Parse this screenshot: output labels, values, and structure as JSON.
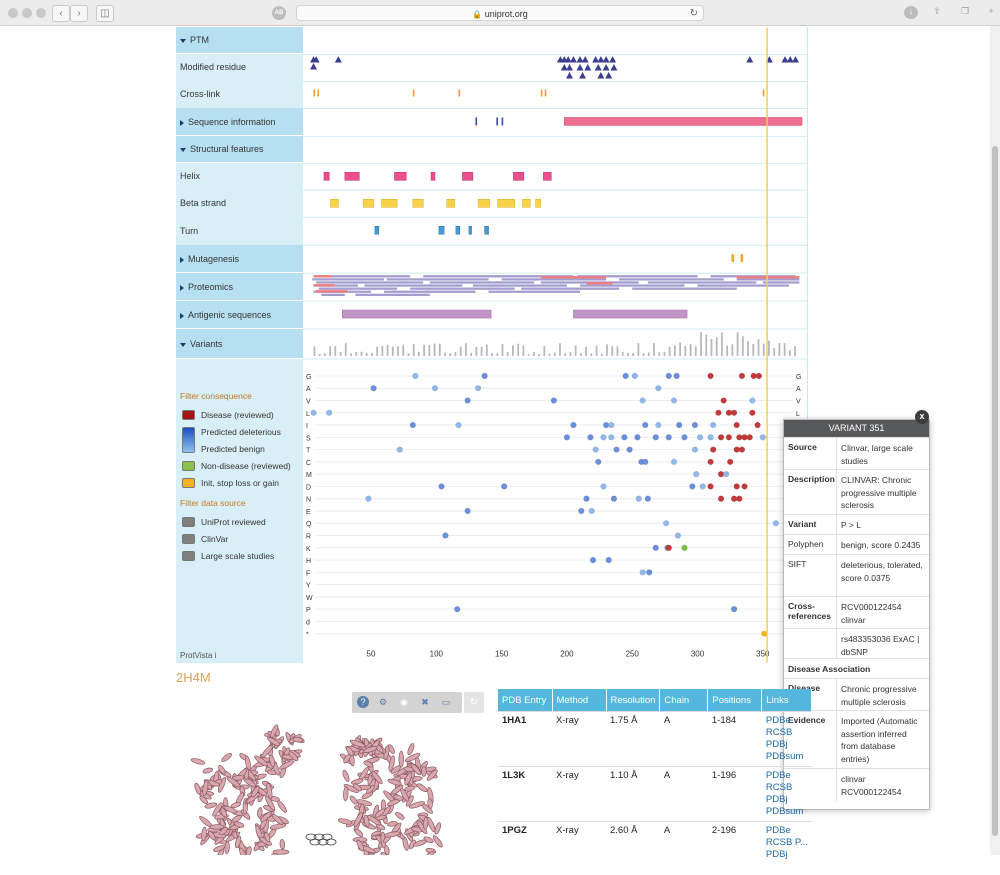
{
  "browser": {
    "url": "uniprot.org",
    "ab_label": "AB"
  },
  "tracks": {
    "rows": [
      {
        "label": "PTM",
        "type": "category",
        "expanded": true
      },
      {
        "label": "Modified residue",
        "type": "track"
      },
      {
        "label": "Cross-link",
        "type": "track"
      },
      {
        "label": "Sequence information",
        "type": "category",
        "expanded": false
      },
      {
        "label": "Structural features",
        "type": "category",
        "expanded": true
      },
      {
        "label": "Helix",
        "type": "track"
      },
      {
        "label": "Beta strand",
        "type": "track"
      },
      {
        "label": "Turn",
        "type": "track"
      },
      {
        "label": "Mutagenesis",
        "type": "category",
        "expanded": false
      },
      {
        "label": "Proteomics",
        "type": "category",
        "expanded": false
      },
      {
        "label": "Antigenic sequences",
        "type": "category",
        "expanded": false
      },
      {
        "label": "Variants",
        "type": "category",
        "expanded": true
      }
    ],
    "residues": [
      "G",
      "A",
      "V",
      "L",
      "I",
      "S",
      "T",
      "C",
      "M",
      "D",
      "N",
      "E",
      "Q",
      "R",
      "K",
      "H",
      "F",
      "Y",
      "W",
      "P",
      "d",
      "*"
    ],
    "x_axis": {
      "ticks": [
        50,
        100,
        150,
        200,
        250,
        300,
        350
      ],
      "min": 1,
      "max": 380
    }
  },
  "legend": {
    "filter_consequence": "Filter consequence",
    "consequence_items": [
      {
        "label": "Disease (reviewed)",
        "color": "#a31515"
      },
      {
        "label": "Predicted deleterious",
        "color": "#2f6dc7"
      },
      {
        "label": "Predicted benign",
        "color": "#a9d3ee"
      },
      {
        "label": "Non-disease (reviewed)",
        "color": "#8bc34a"
      },
      {
        "label": "Init, stop loss or gain",
        "color": "#f5b31d"
      }
    ],
    "filter_source": "Filter data source",
    "source_items": [
      {
        "label": "UniProt reviewed",
        "color": "#808080"
      },
      {
        "label": "ClinVar",
        "color": "#808080"
      },
      {
        "label": "Large scale studies",
        "color": "#808080"
      }
    ],
    "protvista": "ProtVista i"
  },
  "popup": {
    "title": "VARIANT 351",
    "close": "x",
    "rows": [
      {
        "key": "Source",
        "value": "Clinvar, large scale studies",
        "bold": true
      },
      {
        "key": "Description",
        "value": "CLINVAR: Chronic progressive multiple sclerosis",
        "bold": true
      },
      {
        "key": "Variant",
        "value": "P > L",
        "bold": true
      },
      {
        "key": "Polyphen",
        "value": "benign, score 0.2435",
        "bold": false
      },
      {
        "key": "SIFT",
        "value": "deleterious, tolerated, score 0.0375",
        "bold": false
      },
      {
        "key": "Cross-references",
        "value": "RCV000122454 clinvar",
        "bold": true
      },
      {
        "key": "",
        "value": "rs483353036 ExAC | dbSNP",
        "bold": false
      }
    ],
    "disease_heading": "Disease Association",
    "disease_rows": [
      {
        "key": "Disease",
        "value": "Chronic progressive multiple sclerosis",
        "bold": true
      },
      {
        "key": "Evidence",
        "value": "Imported (Automatic assertion inferred from database entries)",
        "bold": true
      },
      {
        "key": "",
        "value": "clinvar RCV000122454",
        "bold": false
      }
    ]
  },
  "structure": {
    "title": "2H4M",
    "toolbar_icons": [
      "help-icon",
      "settings-icon",
      "camera-icon",
      "tools-icon",
      "window-icon"
    ],
    "columns": [
      "PDB Entry",
      "Method",
      "Resolution",
      "Chain",
      "Positions",
      "Links"
    ],
    "rows": [
      {
        "entry": "1HA1",
        "method": "X-ray",
        "resolution": "1.75 Å",
        "chain": "A",
        "positions": "1-184",
        "links": [
          "PDBe",
          "RCSB",
          "PDBj",
          "PDBsum"
        ]
      },
      {
        "entry": "1L3K",
        "method": "X-ray",
        "resolution": "1.10 Å",
        "chain": "A",
        "positions": "1-196",
        "links": [
          "PDBe",
          "RCSB",
          "PDBj",
          "PDBsum"
        ]
      },
      {
        "entry": "1PGZ",
        "method": "X-ray",
        "resolution": "2.60 Å",
        "chain": "A",
        "positions": "2-196",
        "links": [
          "PDBe",
          "RCSB P...",
          "PDBj"
        ]
      }
    ]
  }
}
